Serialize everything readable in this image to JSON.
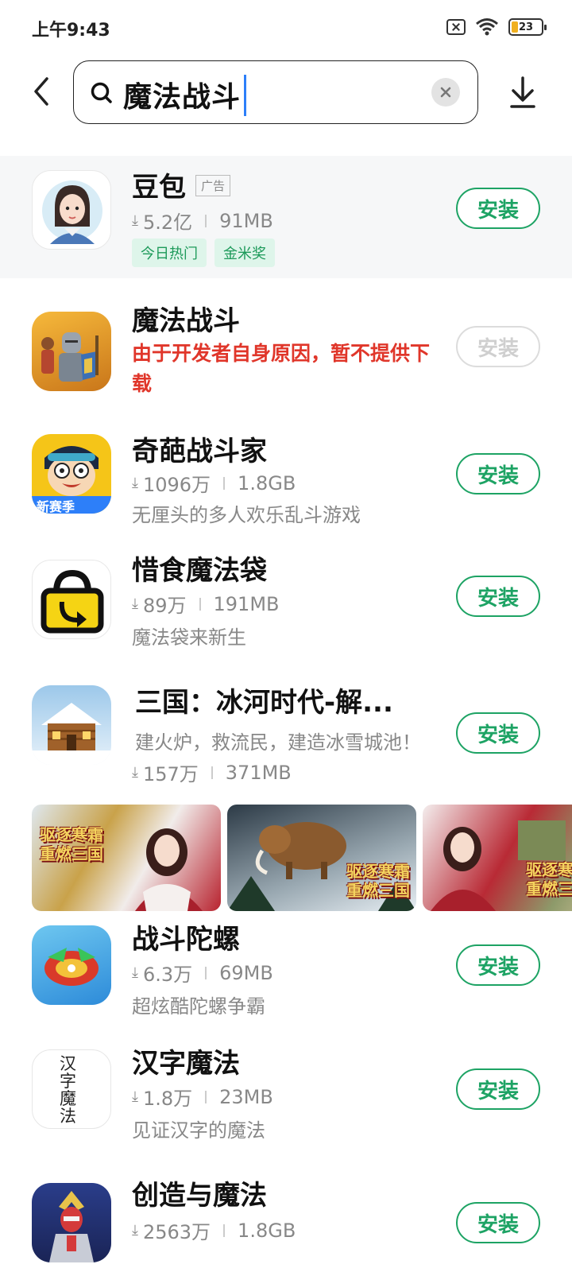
{
  "status_bar": {
    "time": "上午9:43",
    "battery": "23"
  },
  "search": {
    "query": "魔法战斗"
  },
  "apps": [
    {
      "name": "豆包",
      "ad_label": "广告",
      "downloads": "5.2亿",
      "size": "91MB",
      "tags": [
        "今日热门",
        "金米奖"
      ],
      "button": "安装"
    },
    {
      "name": "魔法战斗",
      "warning": "由于开发者自身原因，暂不提供下载",
      "button": "安装",
      "button_disabled": true
    },
    {
      "name": "奇葩战斗家",
      "downloads": "1096万",
      "size": "1.8GB",
      "description": "无厘头的多人欢乐乱斗游戏",
      "button": "安装",
      "icon_badge": "新赛季"
    },
    {
      "name": "惜食魔法袋",
      "downloads": "89万",
      "size": "191MB",
      "description": "魔法袋来新生",
      "button": "安装"
    },
    {
      "name": "三国：冰河时代-解...",
      "description": "建火炉，救流民，建造冰雪城池！",
      "downloads": "157万",
      "size": "371MB",
      "button": "安装",
      "screenshot_text": [
        "驱逐寒霜",
        "重燃三国"
      ]
    },
    {
      "name": "战斗陀螺",
      "downloads": "6.3万",
      "size": "69MB",
      "description": "超炫酷陀螺争霸",
      "button": "安装"
    },
    {
      "name": "汉字魔法",
      "downloads": "1.8万",
      "size": "23MB",
      "description": "见证汉字的魔法",
      "button": "安装",
      "icon_text": "汉字魔法"
    },
    {
      "name": "创造与魔法",
      "downloads": "2563万",
      "size": "1.8GB",
      "button": "安装"
    }
  ],
  "colors": {
    "accent_green": "#1da364",
    "warning_red": "#e0362a",
    "tag_bg": "#def5ea"
  }
}
